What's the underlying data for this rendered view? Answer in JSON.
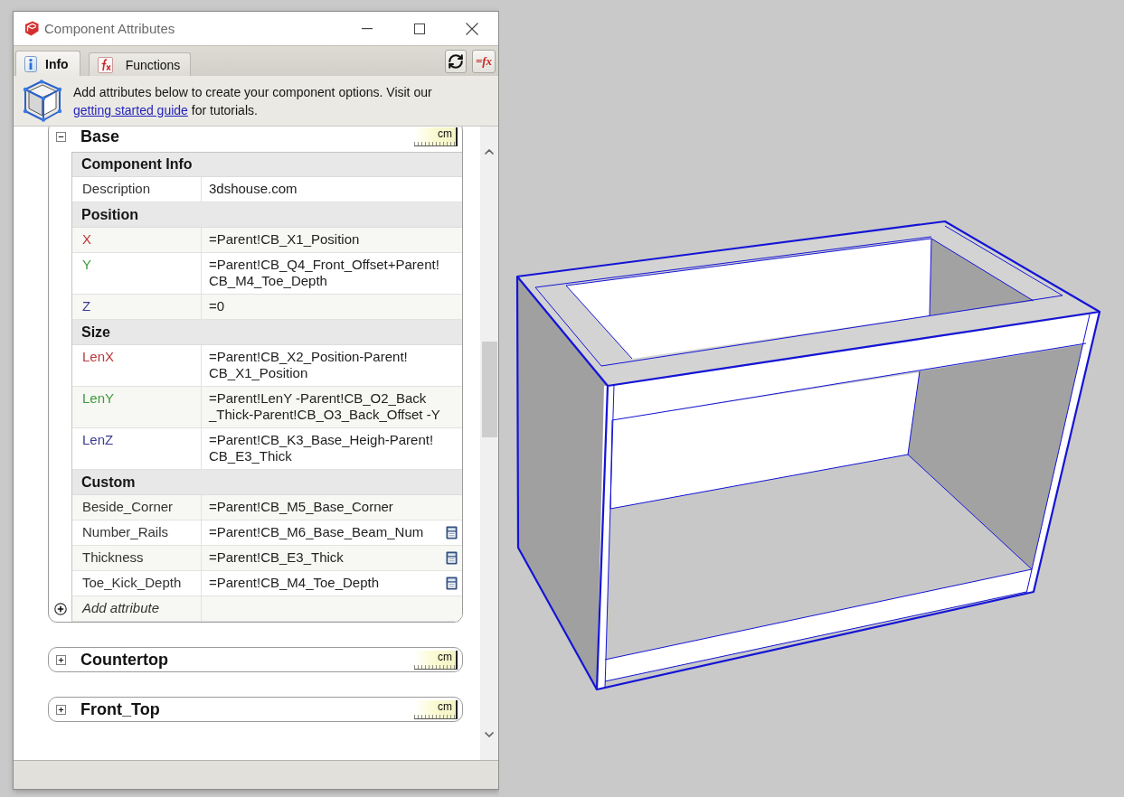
{
  "window": {
    "title": "Component Attributes"
  },
  "tabs": [
    {
      "label": "Info",
      "kind": "info",
      "selected": true
    },
    {
      "label": "Functions",
      "kind": "functions",
      "selected": false
    }
  ],
  "toolbar_buttons": [
    {
      "kind": "refresh"
    },
    {
      "kind": "formula",
      "label": "=fx"
    }
  ],
  "banner": {
    "text": "Add attributes below to create your component options. Visit our",
    "link": "getting started guide",
    "text_after": "for tutorials."
  },
  "panels": [
    {
      "title": "Base",
      "expanded": true,
      "units": "cm",
      "sections": [
        {
          "title": "Component Info",
          "attributes": [
            {
              "name": "Description",
              "value": "3dshouse.com",
              "options_button": false
            }
          ]
        },
        {
          "title": "Position",
          "attributes": [
            {
              "name": "X",
              "color": "#b83a3a",
              "value": "=Parent!CB_X1_Position",
              "options_button": false
            },
            {
              "name": "Y",
              "color": "#3c9a3c",
              "value": "=Parent!CB_Q4_Front_Offset+Parent!CB_M4_Toe_Depth",
              "options_button": false
            },
            {
              "name": "Z",
              "color": "#3a3a90",
              "value": "=0",
              "options_button": false
            }
          ]
        },
        {
          "title": "Size",
          "attributes": [
            {
              "name": "LenX",
              "color": "#b83a3a",
              "value": "=Parent!CB_X2_Position-Parent!CB_X1_Position",
              "options_button": false
            },
            {
              "name": "LenY",
              "color": "#3c9a3c",
              "value": "=Parent!LenY -Parent!CB_O2_Back _Thick-Parent!CB_O3_Back_Offset -Y",
              "options_button": false
            },
            {
              "name": "LenZ",
              "color": "#3a3a90",
              "value": "=Parent!CB_K3_Base_Heigh-Parent!CB_E3_Thick",
              "options_button": false
            }
          ]
        },
        {
          "title": "Custom",
          "attributes": [
            {
              "name": "Beside_Corner",
              "value": "=Parent!CB_M5_Base_Corner",
              "options_button": false
            },
            {
              "name": "Number_Rails",
              "value": "=Parent!CB_M6_Base_Beam_Num",
              "options_button": true
            },
            {
              "name": "Thickness",
              "value": "=Parent!CB_E3_Thick",
              "options_button": true
            },
            {
              "name": "Toe_Kick_Depth",
              "value": "=Parent!CB_M4_Toe_Depth",
              "options_button": true
            }
          ]
        }
      ],
      "add_attribute": "Add attribute"
    },
    {
      "title": "Countertop",
      "expanded": false,
      "units": "cm"
    },
    {
      "title": "Front_Top",
      "expanded": false,
      "units": "cm"
    }
  ]
}
